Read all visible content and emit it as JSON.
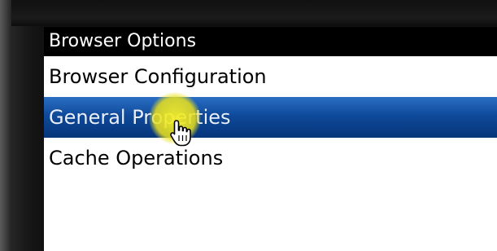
{
  "menu": {
    "title": "Browser Options",
    "items": [
      {
        "label": "Browser Configuration",
        "selected": false
      },
      {
        "label": "General Properties",
        "selected": true
      },
      {
        "label": "Cache Operations",
        "selected": false
      }
    ]
  },
  "cursor": {
    "icon": "hand-pointer-icon",
    "highlight_color": "#F0E61E"
  },
  "colors": {
    "selection": "#0F4A9A",
    "title_bar": "#000000"
  }
}
